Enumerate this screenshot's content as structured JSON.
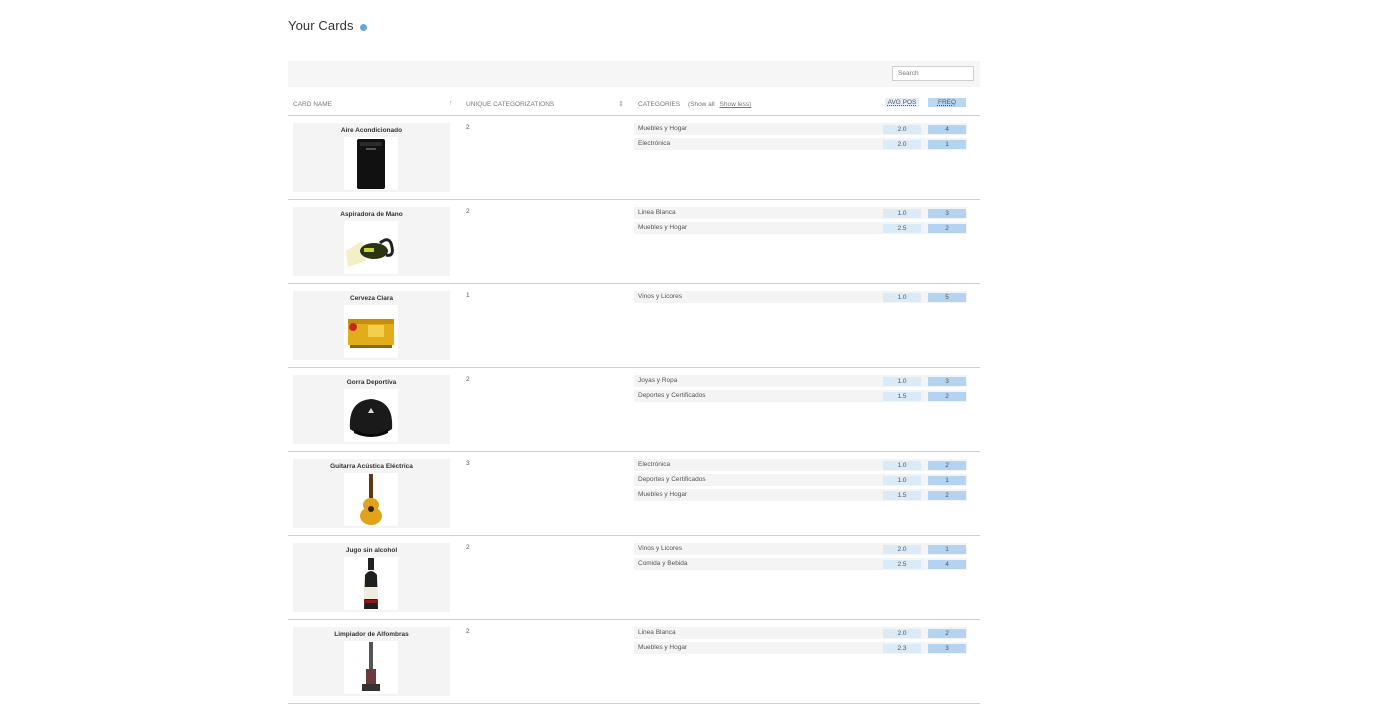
{
  "page": {
    "title": "Your Cards",
    "help_icon": "info-icon"
  },
  "search": {
    "placeholder": "Search"
  },
  "columns": {
    "card_name": "CARD NAME",
    "unique": "UNIQUE CATEGORIZATIONS",
    "categories": "CATEGORIES",
    "show_all": "(Show all",
    "show_less": "Show less)",
    "avg_pos": "AVG POS",
    "freq": "FREQ"
  },
  "cards": [
    {
      "name": "Aire Acondicionado",
      "image": "air-conditioner-image",
      "unique": "2",
      "categories": [
        {
          "name": "Muebles y Hogar",
          "avg": "2.0",
          "freq": "4"
        },
        {
          "name": "Electrónica",
          "avg": "2.0",
          "freq": "1"
        }
      ]
    },
    {
      "name": "Aspiradora de Mano",
      "image": "hand-vacuum-image",
      "unique": "2",
      "categories": [
        {
          "name": "Linea Blanca",
          "avg": "1.0",
          "freq": "3"
        },
        {
          "name": "Muebles y Hogar",
          "avg": "2.5",
          "freq": "2"
        }
      ]
    },
    {
      "name": "Cerveza Clara",
      "image": "beer-box-image",
      "unique": "1",
      "categories": [
        {
          "name": "Vinos y Licores",
          "avg": "1.0",
          "freq": "5"
        }
      ]
    },
    {
      "name": "Gorra Deportiva",
      "image": "cap-image",
      "unique": "2",
      "categories": [
        {
          "name": "Joyas y Ropa",
          "avg": "1.0",
          "freq": "3"
        },
        {
          "name": "Deportes y Certificados",
          "avg": "1.5",
          "freq": "2"
        }
      ]
    },
    {
      "name": "Guitarra Acústica Eléctrica",
      "image": "guitar-image",
      "unique": "3",
      "categories": [
        {
          "name": "Electrónica",
          "avg": "1.0",
          "freq": "2"
        },
        {
          "name": "Deportes y Certificados",
          "avg": "1.0",
          "freq": "1"
        },
        {
          "name": "Muebles y Hogar",
          "avg": "1.5",
          "freq": "2"
        }
      ]
    },
    {
      "name": "Jugo sin alcohol",
      "image": "bottle-image",
      "unique": "2",
      "categories": [
        {
          "name": "Vinos y Licores",
          "avg": "2.0",
          "freq": "1"
        },
        {
          "name": "Comida y Bebida",
          "avg": "2.5",
          "freq": "4"
        }
      ]
    },
    {
      "name": "Limpiador de Alfombras",
      "image": "carpet-cleaner-image",
      "unique": "2",
      "categories": [
        {
          "name": "Linea Blanca",
          "avg": "2.0",
          "freq": "2"
        },
        {
          "name": "Muebles y Hogar",
          "avg": "2.3",
          "freq": "3"
        }
      ]
    }
  ]
}
